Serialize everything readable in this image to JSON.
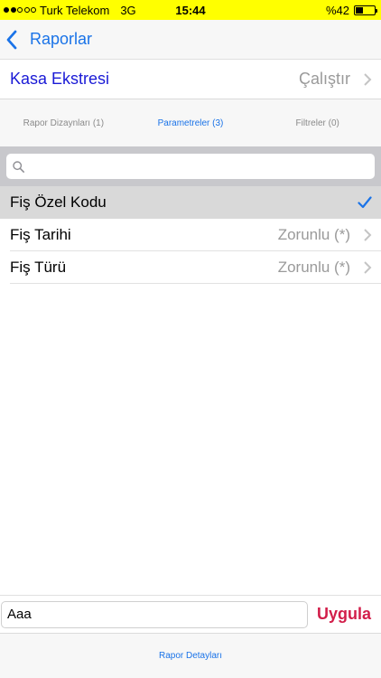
{
  "status_bar": {
    "carrier": "Turk Telekom",
    "network": "3G",
    "time": "15:44",
    "battery": "%42",
    "battery_level": 0.42,
    "signal_dots_filled": 2,
    "background_color": "#ffff00"
  },
  "nav": {
    "back_label": "Raporlar",
    "back_icon": "chevron-left-icon"
  },
  "report": {
    "title": "Kasa Ekstresi",
    "run_label": "Çalıştır"
  },
  "tabs": [
    {
      "label": "Rapor Dizaynları (1)",
      "active": false
    },
    {
      "label": "Parametreler (3)",
      "active": true
    },
    {
      "label": "Filtreler (0)",
      "active": false
    }
  ],
  "search": {
    "placeholder": "",
    "value": ""
  },
  "parameters": [
    {
      "label": "Fiş Özel Kodu",
      "status": "",
      "selected": true
    },
    {
      "label": "Fiş Tarihi",
      "status": "Zorunlu (*)",
      "selected": false
    },
    {
      "label": "Fiş Türü",
      "status": "Zorunlu (*)",
      "selected": false
    }
  ],
  "apply": {
    "input_value": "Aaa",
    "button_label": "Uygula"
  },
  "footer": {
    "link_label": "Rapor Detayları"
  },
  "colors": {
    "accent": "#1a73e8",
    "title": "#1a1ad6",
    "apply": "#d21e4a"
  }
}
